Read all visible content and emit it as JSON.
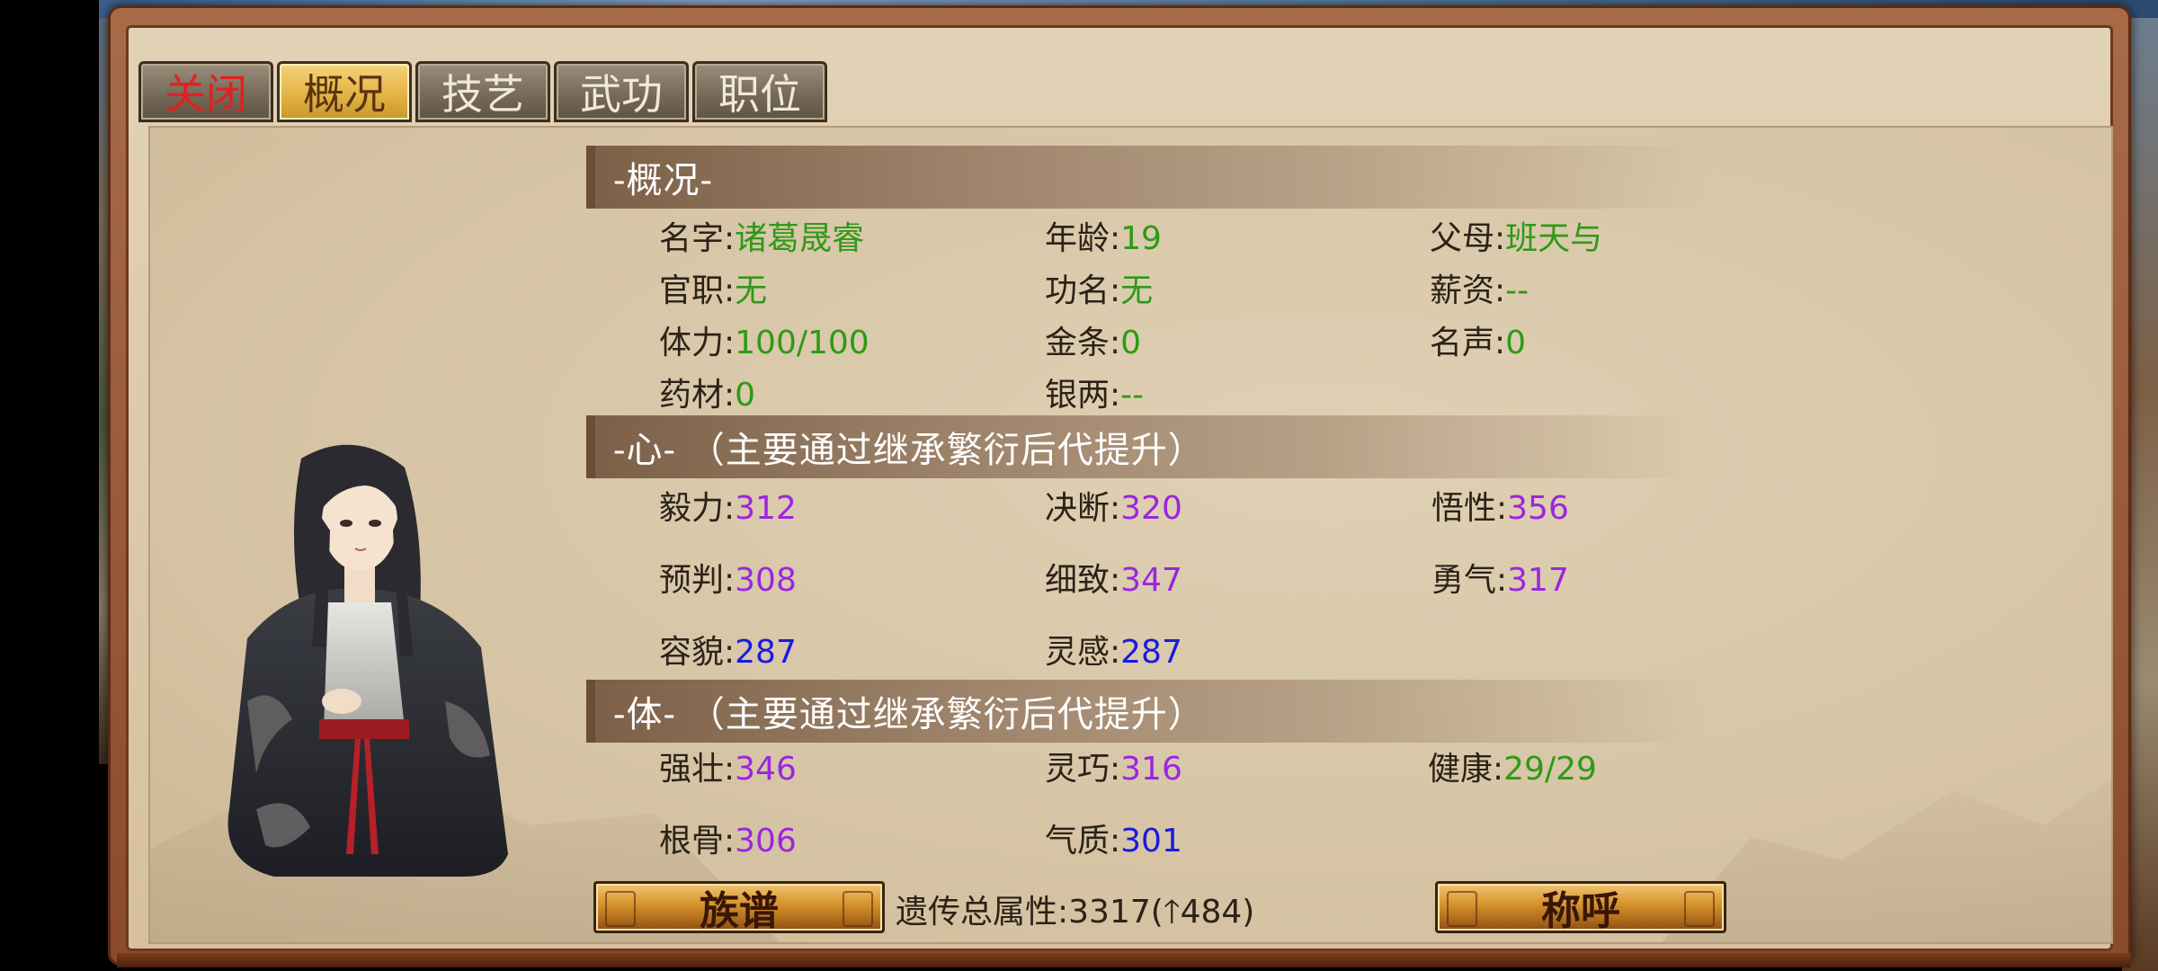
{
  "tabs": [
    {
      "label": "关闭",
      "state": "close"
    },
    {
      "label": "概况",
      "state": "active"
    },
    {
      "label": "技艺",
      "state": "normal"
    },
    {
      "label": "武功",
      "state": "normal"
    },
    {
      "label": "职位",
      "state": "normal"
    }
  ],
  "overview": {
    "header": "-概况-",
    "name_label": "名字",
    "name_value": "诸葛晟睿",
    "age_label": "年龄",
    "age_value": "19",
    "parent_label": "父母",
    "parent_value": "班天与",
    "office_label": "官职",
    "office_value": "无",
    "rank_label": "功名",
    "rank_value": "无",
    "salary_label": "薪资",
    "salary_value": "--",
    "stamina_label": "体力",
    "stamina_value": "100/100",
    "gold_label": "金条",
    "gold_value": "0",
    "fame_label": "名声",
    "fame_value": "0",
    "herbs_label": "药材",
    "herbs_value": "0",
    "silver_label": "银两",
    "silver_value": "--"
  },
  "mind": {
    "header": "-心- （主要通过继承繁衍后代提升）",
    "stat1_label": "毅力",
    "stat1_value": "312",
    "stat2_label": "决断",
    "stat2_value": "320",
    "stat3_label": "悟性",
    "stat3_value": "356",
    "stat4_label": "预判",
    "stat4_value": "308",
    "stat5_label": "细致",
    "stat5_value": "347",
    "stat6_label": "勇气",
    "stat6_value": "317",
    "stat7_label": "容貌",
    "stat7_value": "287",
    "stat8_label": "灵感",
    "stat8_value": "287"
  },
  "body_stats": {
    "header": "-体- （主要通过继承繁衍后代提升）",
    "stat1_label": "强壮",
    "stat1_value": "346",
    "stat2_label": "灵巧",
    "stat2_value": "316",
    "stat3_label": "健康",
    "stat3_value": "29/29",
    "stat4_label": "根骨",
    "stat4_value": "306",
    "stat5_label": "气质",
    "stat5_value": "301"
  },
  "footer": {
    "genealogy_button": "族谱",
    "genetics_label": "遗传总属性",
    "genetics_value": "3317",
    "genetics_delta": "484",
    "title_button": "称呼"
  },
  "colors": {
    "green": "#2e9a16",
    "purple": "#9b25e0",
    "blue": "#1a1ae0",
    "close_red": "#e32020",
    "active_tab_gold": "#e3b446"
  }
}
